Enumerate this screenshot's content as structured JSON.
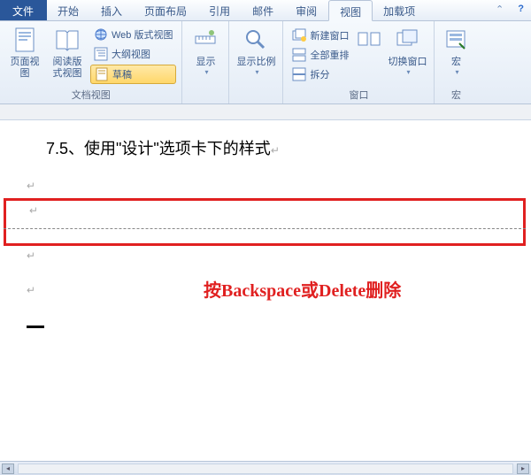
{
  "tabs": {
    "file": "文件",
    "home": "开始",
    "insert": "插入",
    "layout": "页面布局",
    "references": "引用",
    "mail": "邮件",
    "review": "审阅",
    "view": "视图",
    "addins": "加载项"
  },
  "ribbon": {
    "groups": {
      "views": {
        "label": "文档视图",
        "page_view": "页面视图",
        "read_view": "阅读版式视图",
        "web_view": "Web 版式视图",
        "outline_view": "大纲视图",
        "draft": "草稿"
      },
      "show": {
        "label": "显示",
        "btn": "显示"
      },
      "zoom": {
        "label": "",
        "btn": "显示比例"
      },
      "window": {
        "label": "窗口",
        "new_window": "新建窗口",
        "arrange_all": "全部重排",
        "split": "拆分",
        "switch": "切换窗口"
      },
      "macros": {
        "label": "宏",
        "btn": "宏"
      }
    }
  },
  "document": {
    "heading": "7.5、使用\"设计\"选项卡下的样式",
    "annotation": "按Backspace或Delete删除"
  }
}
